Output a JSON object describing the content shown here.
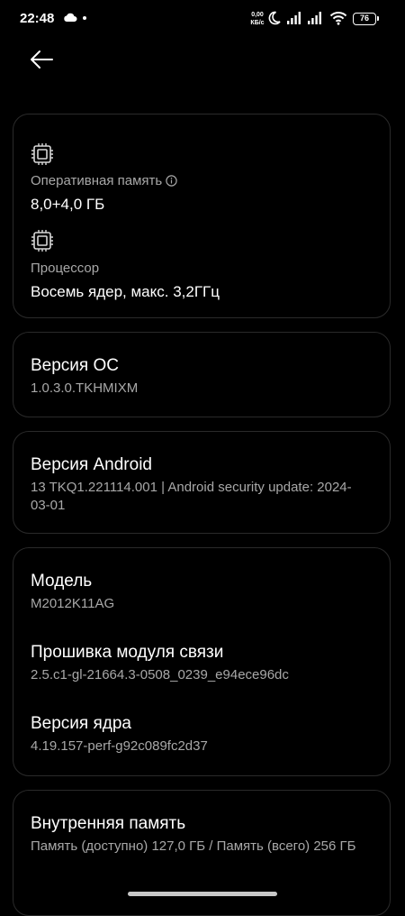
{
  "status_bar": {
    "time": "22:48",
    "net_speed_value": "0,00",
    "net_speed_unit": "КБ/с",
    "battery": "76"
  },
  "specs": {
    "ram_label": "Оперативная память",
    "ram_value": "8,0+4,0 ГБ",
    "cpu_label": "Процессор",
    "cpu_value": "Восемь ядер, макс. 3,2ГГц"
  },
  "os_version": {
    "title": "Версия ОС",
    "value": "1.0.3.0.TKHMIXM"
  },
  "android_version": {
    "title": "Версия Android",
    "value": "13 TKQ1.221114.001 | Android security update: 2024-03-01"
  },
  "device": {
    "model_title": "Модель",
    "model_value": "M2012K11AG",
    "baseband_title": "Прошивка модуля связи",
    "baseband_value": "2.5.c1-gl-21664.3-0508_0239_e94ece96dc",
    "kernel_title": "Версия ядра",
    "kernel_value": "4.19.157-perf-g92c089fc2d37"
  },
  "storage": {
    "title": "Внутренняя память",
    "value": "Память (доступно)  127,0 ГБ / Память (всего) 256 ГБ"
  }
}
